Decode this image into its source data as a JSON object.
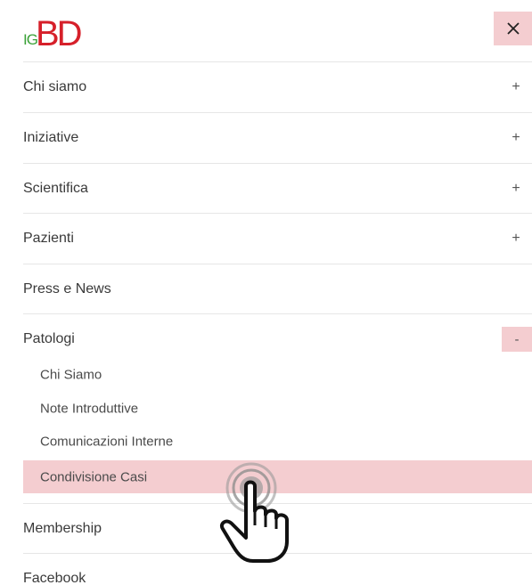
{
  "brand": {
    "logo_prefix": "IG",
    "logo_main": "BD",
    "logo_prefix_color": "#3aa137",
    "logo_main_color": "#d6202a"
  },
  "header": {
    "close_icon": "close-icon",
    "close_glyph": "✕"
  },
  "menu": {
    "items": [
      {
        "label": "Chi siamo",
        "toggle": "+"
      },
      {
        "label": "Iniziative",
        "toggle": "+"
      },
      {
        "label": "Scientifica",
        "toggle": "+"
      },
      {
        "label": "Pazienti",
        "toggle": "+"
      },
      {
        "label": "Press e News",
        "toggle": ""
      },
      {
        "label": "Patologi",
        "toggle": "-"
      },
      {
        "label": "Membership",
        "toggle": ""
      },
      {
        "label": "Facebook",
        "toggle": ""
      }
    ],
    "submenu": [
      {
        "label": "Chi Siamo"
      },
      {
        "label": "Note Introduttive"
      },
      {
        "label": "Comunicazioni Interne"
      },
      {
        "label": "Condivisione Casi"
      }
    ],
    "active_submenu_index": 3
  },
  "colors": {
    "highlight": "#f4cdd0",
    "divider": "#e6e6e6",
    "text": "#3a3a3a"
  }
}
